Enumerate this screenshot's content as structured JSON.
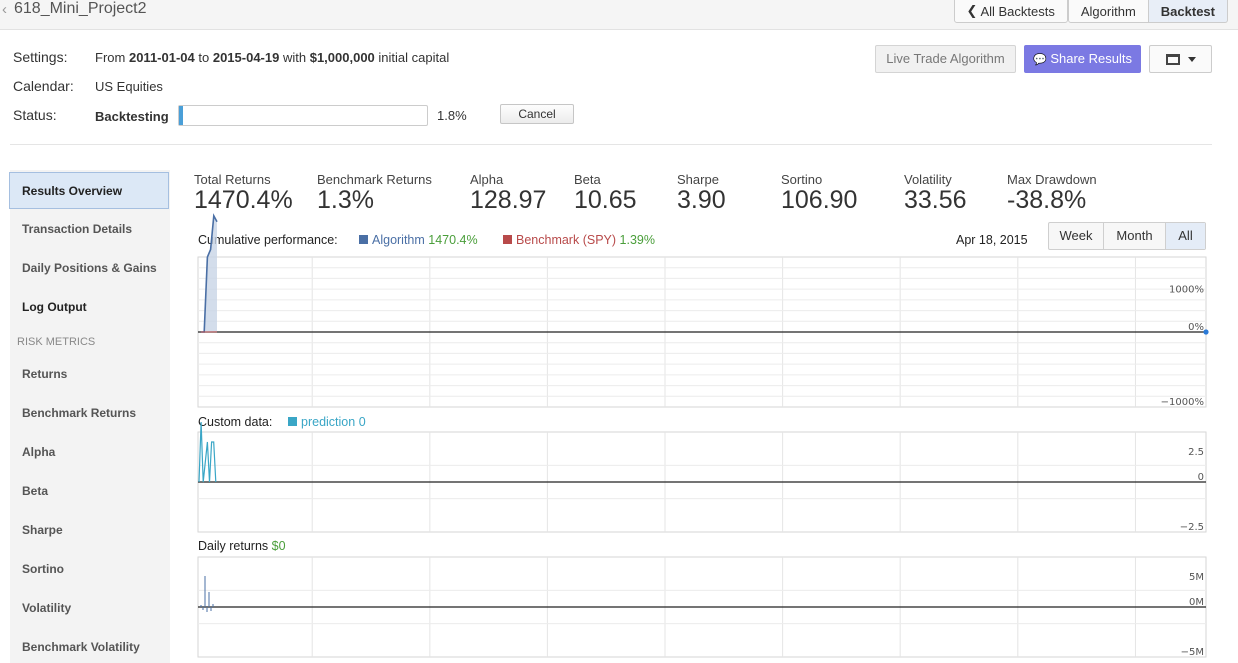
{
  "header": {
    "project_title": "618_Mini_Project2",
    "nav": [
      {
        "label": "All Backtests"
      },
      {
        "label": "Algorithm"
      },
      {
        "label": "Backtest"
      }
    ]
  },
  "settings": {
    "settings_label": "Settings:",
    "from_text": "From",
    "start_date": "2011-01-04",
    "to_text": "to",
    "end_date": "2015-04-19",
    "with_text": "with",
    "capital": "$1,000,000",
    "capital_suffix": "initial capital",
    "calendar_label": "Calendar:",
    "calendar_value": "US Equities",
    "status_label": "Status:",
    "status_value": "Backtesting",
    "progress_percent": 1.8,
    "progress_text": "1.8%",
    "cancel_label": "Cancel"
  },
  "actions": {
    "live_trade": "Live Trade Algorithm",
    "share": "Share Results"
  },
  "sidebar": {
    "items": [
      {
        "label": "Results Overview"
      },
      {
        "label": "Transaction Details"
      },
      {
        "label": "Daily Positions & Gains"
      },
      {
        "label": "Log Output"
      }
    ],
    "risk_heading": "RISK METRICS",
    "risk_items": [
      {
        "label": "Returns"
      },
      {
        "label": "Benchmark Returns"
      },
      {
        "label": "Alpha"
      },
      {
        "label": "Beta"
      },
      {
        "label": "Sharpe"
      },
      {
        "label": "Sortino"
      },
      {
        "label": "Volatility"
      },
      {
        "label": "Benchmark Volatility"
      }
    ]
  },
  "metrics": [
    {
      "label": "Total Returns",
      "value": "1470.4%"
    },
    {
      "label": "Benchmark Returns",
      "value": "1.3%"
    },
    {
      "label": "Alpha",
      "value": "128.97"
    },
    {
      "label": "Beta",
      "value": "10.65"
    },
    {
      "label": "Sharpe",
      "value": "3.90"
    },
    {
      "label": "Sortino",
      "value": "106.90"
    },
    {
      "label": "Volatility",
      "value": "33.56"
    },
    {
      "label": "Max Drawdown",
      "value": "-38.8%"
    }
  ],
  "cumulative": {
    "label": "Cumulative performance:",
    "algo_name": "Algorithm",
    "algo_value": "1470.4%",
    "bench_name": "Benchmark (SPY)",
    "bench_value": "1.39%",
    "date": "Apr 18, 2015",
    "ranges": [
      {
        "label": "Week"
      },
      {
        "label": "Month"
      },
      {
        "label": "All"
      }
    ],
    "y_ticks": [
      "1000%",
      "0%",
      "−1000%"
    ]
  },
  "custom": {
    "label": "Custom data:",
    "series_name": "prediction",
    "series_value": "0",
    "y_ticks": [
      "2.5",
      "0",
      "−2.5"
    ]
  },
  "daily": {
    "label": "Daily returns",
    "value": "$0",
    "y_ticks": [
      "5M",
      "0M",
      "−5M"
    ]
  },
  "colors": {
    "algorithm": "#4a6fa5",
    "benchmark": "#b84a4a",
    "green": "#4a9e3a",
    "prediction": "#3aa6c6",
    "share_button": "#7b79e3"
  },
  "chart_data": [
    {
      "type": "line",
      "title": "Cumulative performance",
      "ylim": [
        -1000,
        1000
      ],
      "series": [
        {
          "name": "Algorithm",
          "x": [
            0,
            1,
            2,
            3,
            4,
            5
          ],
          "values": [
            0,
            0,
            1000,
            1100,
            1550,
            1470
          ]
        },
        {
          "name": "Benchmark (SPY)",
          "x": [
            0,
            5
          ],
          "values": [
            0,
            1.39
          ]
        }
      ]
    },
    {
      "type": "line",
      "title": "Custom data",
      "ylim": [
        -2.5,
        2.5
      ],
      "series": [
        {
          "name": "prediction",
          "values": [
            0,
            3,
            0,
            1,
            2,
            0,
            2,
            2,
            0
          ]
        }
      ]
    },
    {
      "type": "bar",
      "title": "Daily returns",
      "ylim": [
        -5,
        5
      ],
      "values": [
        0.2,
        -0.3,
        3.1,
        -0.5,
        1.5,
        -0.4,
        0.3
      ]
    }
  ]
}
